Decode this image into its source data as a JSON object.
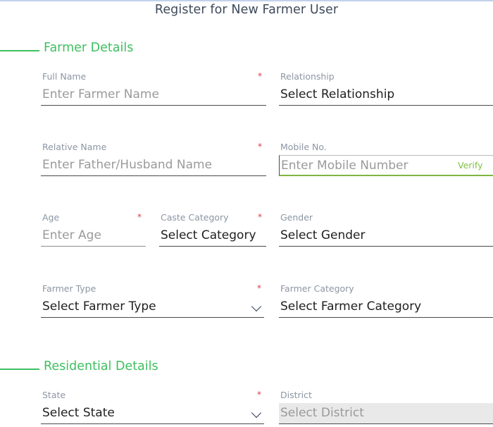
{
  "page": {
    "title": "Register for New Farmer User"
  },
  "sections": {
    "farmer": {
      "title": "Farmer Details"
    },
    "residential": {
      "title": "Residential Details"
    }
  },
  "fields": {
    "full_name": {
      "label": "Full Name",
      "placeholder": "Enter Farmer Name",
      "value": "",
      "required": "*"
    },
    "relationship": {
      "label": "Relationship",
      "placeholder": "Select Relationship",
      "value": "",
      "required": ""
    },
    "relative_name": {
      "label": "Relative Name",
      "placeholder": "Enter Father/Husband Name",
      "value": "",
      "required": "*"
    },
    "mobile_no": {
      "label": "Mobile No.",
      "placeholder": "Enter Mobile Number",
      "value": "",
      "required": "",
      "verify_label": "Verify"
    },
    "age": {
      "label": "Age",
      "placeholder": "Enter Age",
      "value": "",
      "required": "*"
    },
    "caste_category": {
      "label": "Caste Category",
      "placeholder": "Select Category",
      "value": "",
      "required": "*"
    },
    "gender": {
      "label": "Gender",
      "placeholder": "Select Gender",
      "value": "",
      "required": ""
    },
    "farmer_type": {
      "label": "Farmer Type",
      "placeholder": "Select Farmer Type",
      "value": "",
      "required": "*"
    },
    "farmer_category": {
      "label": "Farmer Category",
      "placeholder": "Select Farmer Category",
      "value": "",
      "required": ""
    },
    "state": {
      "label": "State",
      "placeholder": "Select State",
      "value": "",
      "required": "*"
    },
    "district": {
      "label": "District",
      "placeholder": "Select District",
      "value": "",
      "required": ""
    }
  },
  "colors": {
    "accent_green": "#3fc060",
    "verify_green": "#7fc241",
    "required_red": "#e0393e",
    "title_slate": "#3e4a5b",
    "label_grey": "#8c96a3",
    "placeholder_grey": "#9a9a9a",
    "top_rule": "#c3d1ea",
    "disabled_bg": "#e9e9e9"
  }
}
